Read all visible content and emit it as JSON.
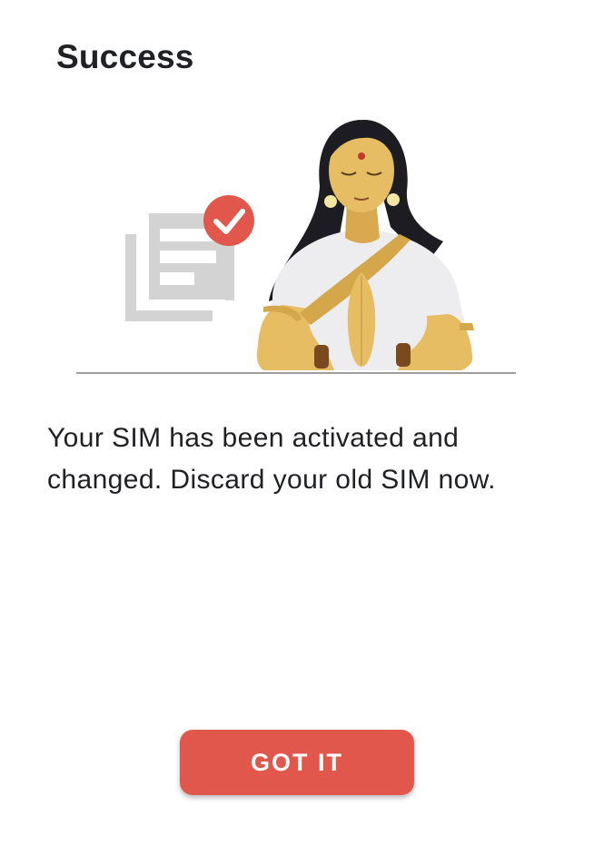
{
  "dialog": {
    "title": "Success",
    "message": "Your SIM has been activated and changed. Discard your old SIM now.",
    "primary_button_label": "GOT IT"
  },
  "illustration": {
    "icons": [
      "document-icon",
      "check-badge-icon",
      "greeting-woman-illustration"
    ]
  },
  "colors": {
    "accent": "#e2574c",
    "text": "#202124",
    "document_grey": "#d3d3d3",
    "skin": "#e6bd63",
    "saree": "#ededf0",
    "hair": "#1c1c22"
  }
}
